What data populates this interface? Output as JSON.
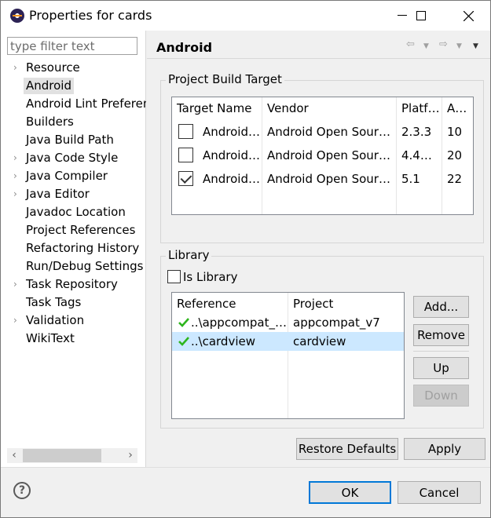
{
  "window": {
    "title": "Properties for cards",
    "minimize": "—",
    "maximize": "☐",
    "close": "✕"
  },
  "filter": {
    "placeholder": "type filter text",
    "value": ""
  },
  "tree": [
    {
      "label": "Resource",
      "expandable": true,
      "selected": false
    },
    {
      "label": "Android",
      "expandable": false,
      "selected": true
    },
    {
      "label": "Android Lint Preferences",
      "expandable": false,
      "selected": false
    },
    {
      "label": "Builders",
      "expandable": false,
      "selected": false
    },
    {
      "label": "Java Build Path",
      "expandable": false,
      "selected": false
    },
    {
      "label": "Java Code Style",
      "expandable": true,
      "selected": false
    },
    {
      "label": "Java Compiler",
      "expandable": true,
      "selected": false
    },
    {
      "label": "Java Editor",
      "expandable": true,
      "selected": false
    },
    {
      "label": "Javadoc Location",
      "expandable": false,
      "selected": false
    },
    {
      "label": "Project References",
      "expandable": false,
      "selected": false
    },
    {
      "label": "Refactoring History",
      "expandable": false,
      "selected": false
    },
    {
      "label": "Run/Debug Settings",
      "expandable": false,
      "selected": false
    },
    {
      "label": "Task Repository",
      "expandable": true,
      "selected": false
    },
    {
      "label": "Task Tags",
      "expandable": false,
      "selected": false
    },
    {
      "label": "Validation",
      "expandable": true,
      "selected": false
    },
    {
      "label": "WikiText",
      "expandable": false,
      "selected": false
    }
  ],
  "page": {
    "title": "Android"
  },
  "build_target": {
    "group_label": "Project Build Target",
    "columns": [
      "Target Name",
      "Vendor",
      "Platf…",
      "A…"
    ],
    "rows": [
      {
        "checked": false,
        "name": "Android…",
        "vendor": "Android Open Sour…",
        "platform": "2.3.3",
        "api": "10"
      },
      {
        "checked": false,
        "name": "Android…",
        "vendor": "Android Open Sour…",
        "platform": "4.4…",
        "api": "20"
      },
      {
        "checked": true,
        "name": "Android…",
        "vendor": "Android Open Sour…",
        "platform": "5.1",
        "api": "22"
      }
    ]
  },
  "library": {
    "group_label": "Library",
    "is_library_label": "Is Library",
    "is_library_checked": false,
    "columns": [
      "Reference",
      "Project"
    ],
    "rows": [
      {
        "reference": "..\\appcompat_…",
        "project": "appcompat_v7",
        "selected": false
      },
      {
        "reference": "..\\cardview",
        "project": "cardview",
        "selected": true
      }
    ],
    "buttons": {
      "add": "Add...",
      "remove": "Remove",
      "up": "Up",
      "down": "Down"
    }
  },
  "actions": {
    "restore_defaults": "Restore Defaults",
    "apply": "Apply",
    "ok": "OK",
    "cancel": "Cancel"
  },
  "icons": {
    "help": "?",
    "app": "eclipse-icon",
    "check_color": "#2db51d"
  }
}
